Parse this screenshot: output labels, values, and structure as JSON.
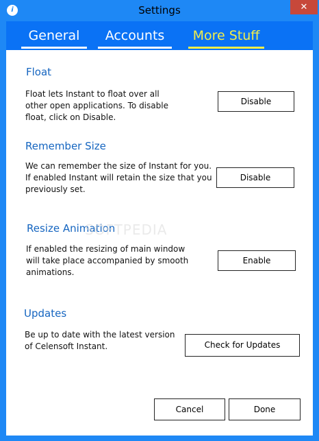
{
  "window": {
    "title": "Settings",
    "close_glyph": "✕"
  },
  "tabs": [
    {
      "label": "General"
    },
    {
      "label": "Accounts"
    },
    {
      "label": "More Stuff"
    }
  ],
  "sections": {
    "float": {
      "title": "Float",
      "description": "Float lets Instant to float over all other open applications. To disable float, click on Disable.",
      "button": "Disable"
    },
    "remember_size": {
      "title": "Remember Size",
      "description": "We can remember the size of Instant for you. If enabled Instant will retain the size that you previously set.",
      "button": "Disable"
    },
    "resize_animation": {
      "title": "Resize Animation",
      "description": "If enabled the resizing of main window will take place accompanied by smooth animations.",
      "button": "Enable"
    },
    "updates": {
      "title": "Updates",
      "description": "Be up to date with the latest version of Celensoft Instant.",
      "button": "Check for Updates"
    }
  },
  "footer": {
    "cancel": "Cancel",
    "done": "Done"
  },
  "watermark": "SOFTPEDIA",
  "colors": {
    "accent": "#1e88f5",
    "active_tab": "#f2ee4a",
    "section_title": "#1565c0"
  }
}
